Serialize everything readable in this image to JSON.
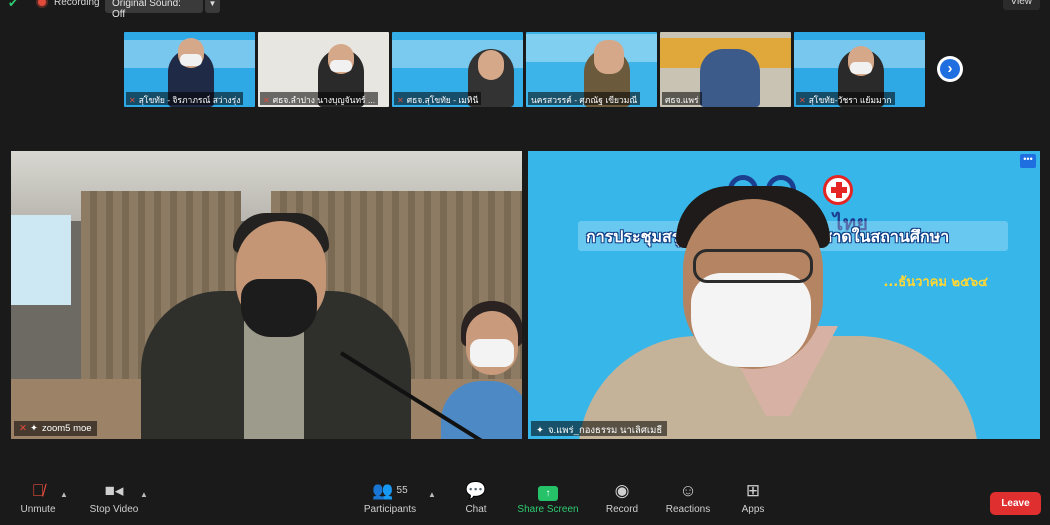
{
  "top": {
    "recording_label": "Recording",
    "original_sound": "Original Sound: Off",
    "view_label": "View"
  },
  "thumbnails": [
    {
      "name": "สุโขทัย - จิรภาภรณ์ สว่างรุ่ง"
    },
    {
      "name": "ศธจ.ลำปาง นางบุญจันทร์ ..."
    },
    {
      "name": "ศธจ.สุโขทัย - เมทินี"
    },
    {
      "name": "นครสวรรค์ - ศุภณัฐ เขียวมณี"
    },
    {
      "name": "ศธจ.แพร่"
    },
    {
      "name": "สุโขทัย-วัชรา แย้มมาก"
    }
  ],
  "main_tiles": {
    "left_name": "zoom5 moe",
    "right_name": "จ.แพร่_กองธรรม นาเลิศเมธี",
    "banner_title": "การประชุมสรุปผล...กิจกรรมยุวกาชาดในสถานศึกษา",
    "banner_date": "...ธันวาคม ๒๕๖๔",
    "banner_logo_text": "ไทย"
  },
  "toolbar": {
    "unmute": "Unmute",
    "stop_video": "Stop Video",
    "participants": "Participants",
    "participant_count": "55",
    "chat": "Chat",
    "share_screen": "Share Screen",
    "record": "Record",
    "reactions": "Reactions",
    "apps": "Apps",
    "leave": "Leave"
  },
  "colors": {
    "accent_blue": "#1f6fe0",
    "share_green": "#2ecc71",
    "leave_red": "#e02f2f",
    "mute_red": "#e04b3c"
  }
}
